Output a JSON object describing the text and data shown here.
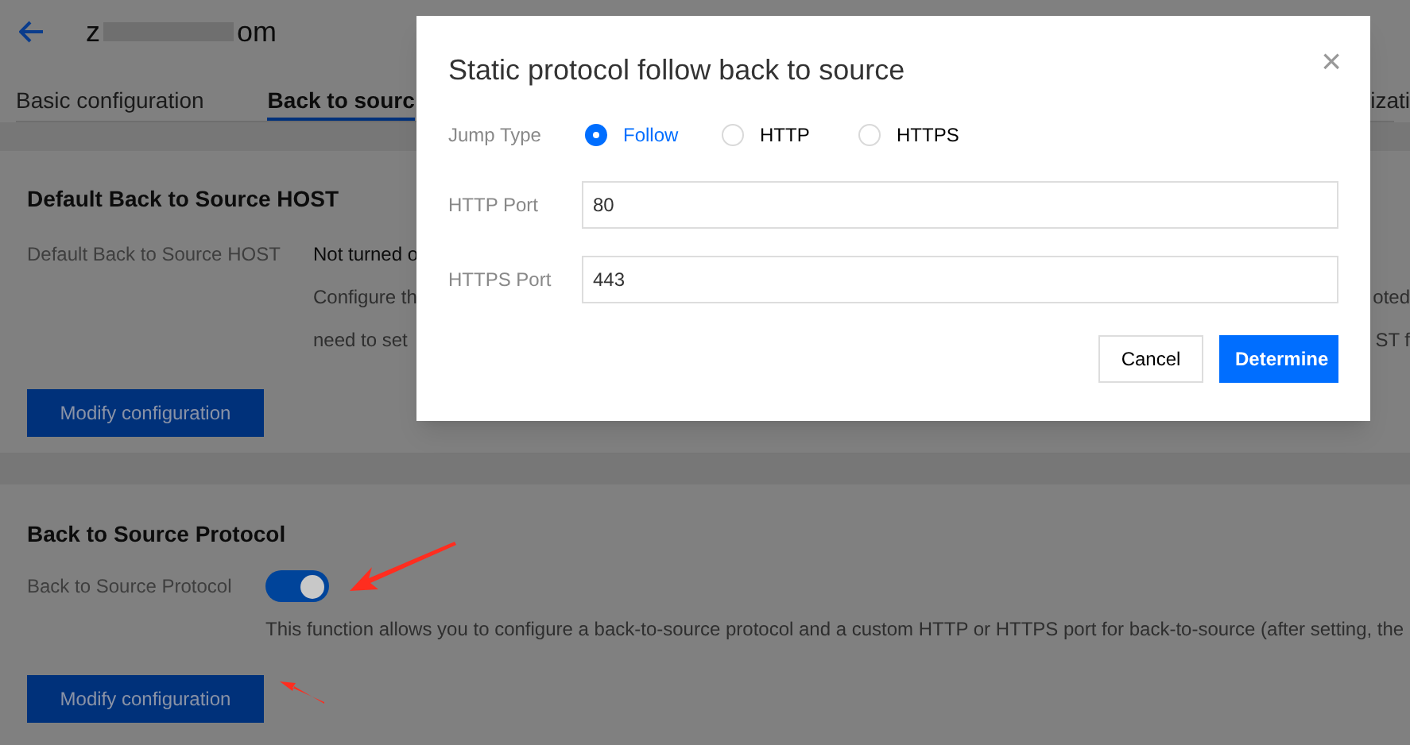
{
  "header": {
    "domain_start": "z",
    "domain_end": "om"
  },
  "tabs": [
    {
      "label": "Basic configuration",
      "selected": false
    },
    {
      "label": "Back to sourc",
      "selected": true
    },
    {
      "label": "izati",
      "selected": false
    }
  ],
  "host_section": {
    "title": "Default Back to Source HOST",
    "label": "Default Back to Source HOST",
    "value": "Not turned o",
    "description_lines": [
      {
        "left": "Configure th",
        "right": "oted"
      },
      {
        "left": "need to set",
        "right": "ST f"
      }
    ],
    "button": "Modify configuration"
  },
  "protocol_section": {
    "title": "Back to Source Protocol",
    "label": "Back to Source Protocol",
    "on": true,
    "description": "This function allows you to configure a back-to-source protocol and a custom HTTP or HTTPS port for back-to-source (after setting, the",
    "button": "Modify configuration"
  },
  "dialog": {
    "title": "Static protocol follow back to source",
    "close": "×",
    "jump_type": {
      "label": "Jump Type",
      "options": [
        {
          "label": "Follow",
          "selected": true
        },
        {
          "label": "HTTP",
          "selected": false
        },
        {
          "label": "HTTPS",
          "selected": false
        }
      ]
    },
    "fields": [
      {
        "label": "HTTP Port",
        "value": "80"
      },
      {
        "label": "HTTPS Port",
        "value": "443"
      }
    ],
    "buttons": [
      {
        "label": "Cancel",
        "kind": "secondary"
      },
      {
        "label": "Determine",
        "kind": "primary"
      }
    ]
  }
}
